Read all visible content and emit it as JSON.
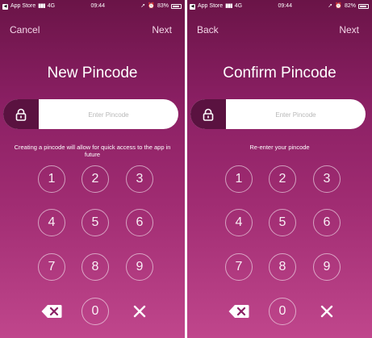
{
  "screens": [
    {
      "status": {
        "carrier": "App Store",
        "network": "4G",
        "time": "09:44",
        "battery_text": "83%",
        "battery_level": 0.83
      },
      "nav": {
        "left": "Cancel",
        "right": "Next"
      },
      "title": "New Pincode",
      "input_placeholder": "Enter Pincode",
      "hint": "Creating a pincode will allow for quick access to the app in future"
    },
    {
      "status": {
        "carrier": "App Store",
        "network": "4G",
        "time": "09:44",
        "battery_text": "82%",
        "battery_level": 0.82
      },
      "nav": {
        "left": "Back",
        "right": "Next"
      },
      "title": "Confirm Pincode",
      "input_placeholder": "Enter Pincode",
      "hint": "Re-enter your pincode"
    }
  ],
  "keypad": [
    "1",
    "2",
    "3",
    "4",
    "5",
    "6",
    "7",
    "8",
    "9",
    "0"
  ],
  "icons": {
    "lock": "lock-icon",
    "backspace": "backspace-icon",
    "close": "close-icon"
  },
  "colors": {
    "gradient_top": "#6a1447",
    "gradient_bottom": "#c0468c",
    "lock_box": "#5a1240"
  }
}
